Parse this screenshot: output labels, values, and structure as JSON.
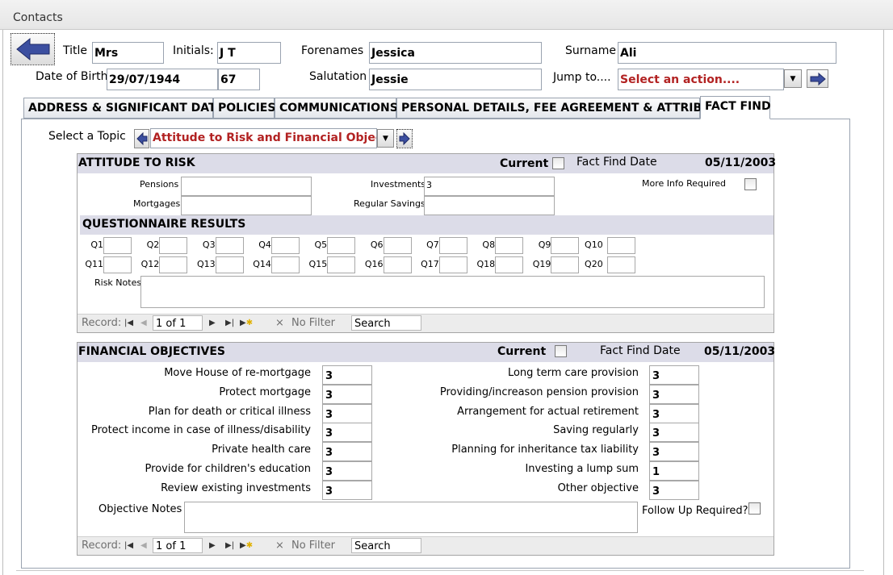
{
  "window": {
    "title": "Contacts"
  },
  "header": {
    "title_label": "Title",
    "title_value": "Mrs",
    "initials_label": "Initials:",
    "initials_value": "J T",
    "forenames_label": "Forenames",
    "forenames_value": "Jessica",
    "surname_label": "Surname",
    "surname_value": "Ali",
    "dob_label": "Date of Birth",
    "dob_value": "29/07/1944",
    "age_value": "67",
    "salutation_label": "Salutation",
    "salutation_value": "Jessie",
    "jump_label": "Jump to....",
    "jump_value": "Select an action...."
  },
  "tabs": [
    {
      "label": "ADDRESS & SIGNIFICANT DATES"
    },
    {
      "label": "POLICIES"
    },
    {
      "label": "COMMUNICATIONS"
    },
    {
      "label": "PERSONAL DETAILS, FEE AGREEMENT & ATTRIBUTES"
    },
    {
      "label": "FACT FIND",
      "active": true
    }
  ],
  "fact_find": {
    "topic_label": "Select a Topic",
    "topic_value": "Attitude to Risk and Financial Objectives",
    "risk": {
      "heading": "ATTITUDE TO RISK",
      "current_label": "Current",
      "fact_find_date_label": "Fact Find Date",
      "fact_find_date": "05/11/2003",
      "pensions_label": "Pensions",
      "pensions_value": "",
      "mortgages_label": "Mortgages",
      "mortgages_value": "",
      "investments_label": "Investments",
      "investments_value": "3",
      "regular_savings_label": "Regular Savings",
      "regular_savings_value": "",
      "more_info_label": "More Info Required",
      "questionnaire_heading": "QUESTIONNAIRE RESULTS",
      "questions": [
        "Q1",
        "Q2",
        "Q3",
        "Q4",
        "Q5",
        "Q6",
        "Q7",
        "Q8",
        "Q9",
        "Q10",
        "Q11",
        "Q12",
        "Q13",
        "Q14",
        "Q15",
        "Q16",
        "Q17",
        "Q18",
        "Q19",
        "Q20"
      ],
      "risk_notes_label": "Risk Notes",
      "record": {
        "label": "Record:",
        "position": "1 of 1",
        "filter": "No Filter",
        "search": "Search"
      }
    },
    "objectives": {
      "heading": "FINANCIAL OBJECTIVES",
      "current_label": "Current",
      "fact_find_date_label": "Fact Find Date",
      "fact_find_date": "05/11/2003",
      "left": [
        {
          "label": "Move House of re-mortgage",
          "value": "3"
        },
        {
          "label": "Protect mortgage",
          "value": "3"
        },
        {
          "label": "Plan for death or critical illness",
          "value": "3"
        },
        {
          "label": "Protect income in case of illness/disability",
          "value": "3"
        },
        {
          "label": "Private health care",
          "value": "3"
        },
        {
          "label": "Provide for children's education",
          "value": "3"
        },
        {
          "label": "Review existing investments",
          "value": "3"
        }
      ],
      "right": [
        {
          "label": "Long term care provision",
          "value": "3"
        },
        {
          "label": "Providing/increason pension provision",
          "value": "3"
        },
        {
          "label": "Arrangement for actual retirement",
          "value": "3"
        },
        {
          "label": "Saving regularly",
          "value": "3"
        },
        {
          "label": "Planning for inheritance tax liability",
          "value": "3"
        },
        {
          "label": "Investing a lump sum",
          "value": "1"
        },
        {
          "label": "Other objective",
          "value": "3"
        }
      ],
      "notes_label": "Objective Notes",
      "follow_up_label": "Follow Up Required?",
      "record": {
        "label": "Record:",
        "position": "1 of 1",
        "filter": "No Filter",
        "search": "Search"
      }
    }
  },
  "colors": {
    "accent_text": "#b22222",
    "section_header": "#dcdce8",
    "nav_arrow": "#3c4fa0"
  }
}
